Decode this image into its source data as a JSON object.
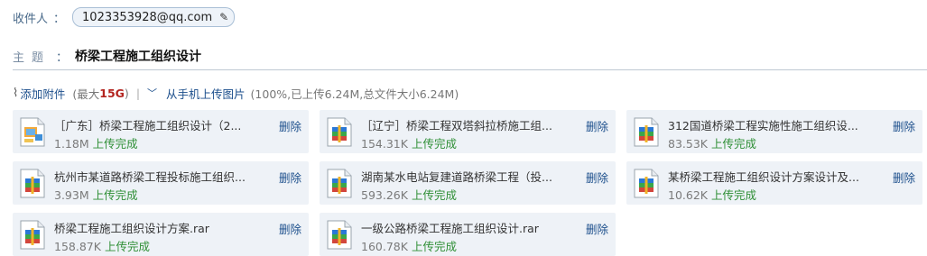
{
  "recipient": {
    "label": "收件人",
    "colon": "：",
    "email": "1023353928@qq.com",
    "edit_icon": "✎"
  },
  "subject": {
    "label": "主题",
    "colon": "：",
    "value": "桥梁工程施工组织设计"
  },
  "attachments": {
    "clip_icon": "⌇",
    "add_label": "添加附件",
    "max_prefix": "(最大",
    "max_value": "15G",
    "max_suffix": ")",
    "separator": "|",
    "chevron": "﹀",
    "phone_upload_label": "从手机上传图片",
    "progress_text": "(100%,已上传6.24M,总文件大小6.24M)"
  },
  "files": [
    {
      "name": "［广东］桥梁工程施工组织设计（2...",
      "size": "1.18M",
      "status": "上传完成",
      "delete_label": "删除",
      "icon": "image-file"
    },
    {
      "name": "［辽宁］桥梁工程双塔斜拉桥施工组...",
      "size": "154.31K",
      "status": "上传完成",
      "delete_label": "删除",
      "icon": "rar-archive"
    },
    {
      "name": "312国道桥梁工程实施性施工组织设...",
      "size": "83.53K",
      "status": "上传完成",
      "delete_label": "删除",
      "icon": "rar-archive"
    },
    {
      "name": "杭州市某道路桥梁工程投标施工组织...",
      "size": "3.93M",
      "status": "上传完成",
      "delete_label": "删除",
      "icon": "rar-archive"
    },
    {
      "name": "湖南某水电站复建道路桥梁工程（投...",
      "size": "593.26K",
      "status": "上传完成",
      "delete_label": "删除",
      "icon": "rar-archive"
    },
    {
      "name": "某桥梁工程施工组织设计方案设计及...",
      "size": "10.62K",
      "status": "上传完成",
      "delete_label": "删除",
      "icon": "rar-archive"
    },
    {
      "name": "桥梁工程施工组织设计方案.rar",
      "size": "158.87K",
      "status": "上传完成",
      "delete_label": "删除",
      "icon": "rar-archive"
    },
    {
      "name": "一级公路桥梁工程施工组织设计.rar",
      "size": "160.78K",
      "status": "上传完成",
      "delete_label": "删除",
      "icon": "rar-archive"
    }
  ]
}
